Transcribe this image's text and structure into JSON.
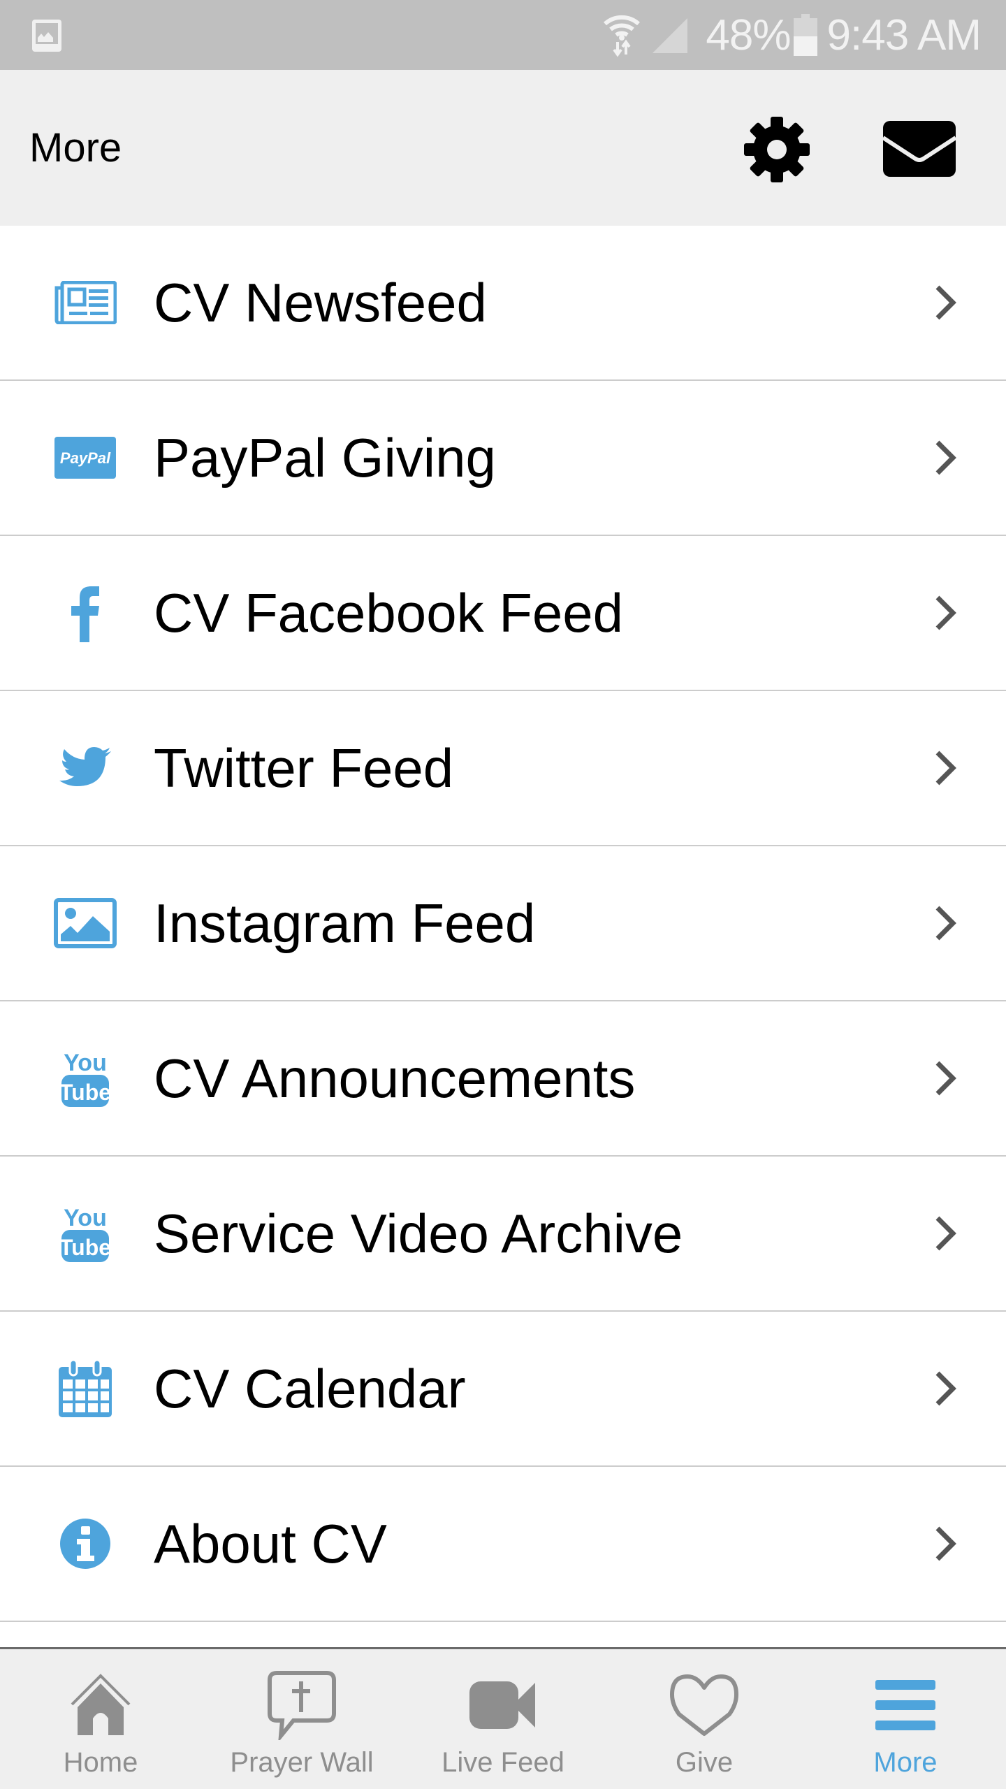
{
  "status_bar": {
    "left_icon": "gallery-notification-icon",
    "wifi_icon": "wifi-data-icon",
    "signal_icon": "cell-signal-icon",
    "battery_percent": "48%",
    "battery_icon": "battery-icon",
    "time": "9:43 AM"
  },
  "header": {
    "title": "More",
    "settings_icon": "gear-icon",
    "mail_icon": "mail-icon"
  },
  "colors": {
    "accent": "#4ea4dc",
    "inactive": "#8e8e8e",
    "chevron": "#555555",
    "divider": "#cccccc",
    "header_bg": "#efefef",
    "status_bg": "#bfbfbf"
  },
  "menu": {
    "items": [
      {
        "label": "CV Newsfeed",
        "icon": "newspaper-icon"
      },
      {
        "label": "PayPal Giving",
        "icon": "paypal-icon",
        "icon_text": "PayPal"
      },
      {
        "label": "CV Facebook Feed",
        "icon": "facebook-icon"
      },
      {
        "label": "Twitter Feed",
        "icon": "twitter-icon"
      },
      {
        "label": "Instagram Feed",
        "icon": "image-icon"
      },
      {
        "label": "CV Announcements",
        "icon": "youtube-icon",
        "icon_text_top": "You",
        "icon_text_bottom": "Tube"
      },
      {
        "label": "Service Video Archive",
        "icon": "youtube-icon",
        "icon_text_top": "You",
        "icon_text_bottom": "Tube"
      },
      {
        "label": "CV Calendar",
        "icon": "calendar-icon"
      },
      {
        "label": "About CV",
        "icon": "info-icon"
      }
    ]
  },
  "bottom_nav": {
    "tabs": [
      {
        "label": "Home",
        "icon": "home-icon",
        "active": false
      },
      {
        "label": "Prayer Wall",
        "icon": "prayer-bubble-icon",
        "active": false
      },
      {
        "label": "Live Feed",
        "icon": "video-camera-icon",
        "active": false
      },
      {
        "label": "Give",
        "icon": "heart-icon",
        "active": false
      },
      {
        "label": "More",
        "icon": "menu-icon",
        "active": true
      }
    ]
  }
}
